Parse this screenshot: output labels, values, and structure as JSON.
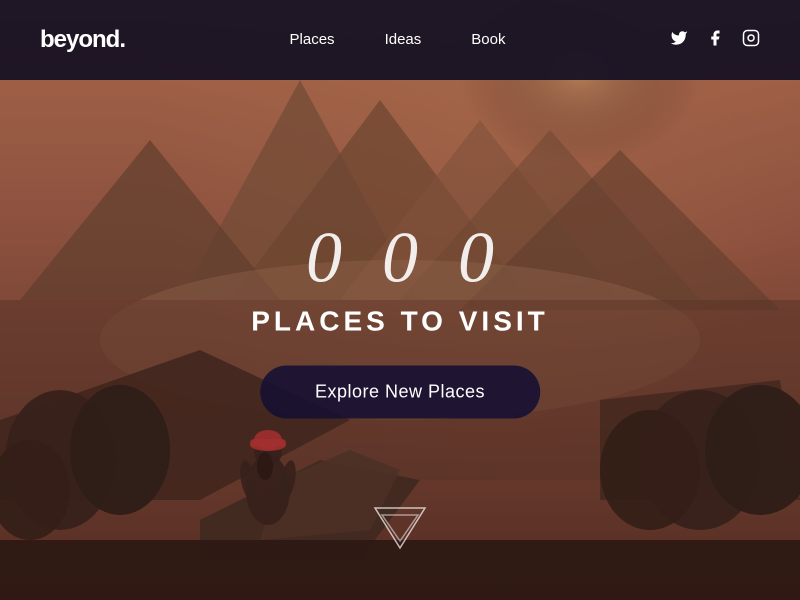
{
  "brand": {
    "logo": "beyond.",
    "dot_color": "#ffffff"
  },
  "nav": {
    "links": [
      {
        "label": "Places",
        "href": "#"
      },
      {
        "label": "Ideas",
        "href": "#"
      },
      {
        "label": "Book",
        "href": "#"
      }
    ],
    "social_icons": [
      {
        "name": "twitter-icon",
        "symbol": "𝕏"
      },
      {
        "name": "facebook-icon",
        "symbol": "f"
      },
      {
        "name": "instagram-icon",
        "symbol": "◻"
      }
    ]
  },
  "hero": {
    "counter": {
      "digits": [
        "0",
        "0",
        "0"
      ]
    },
    "subtitle": "PLACES TO VISIT",
    "cta_label": "Explore New Places"
  },
  "scroll": {
    "label": "scroll down"
  },
  "colors": {
    "navbar_bg": "rgba(20,15,35,0.92)",
    "cta_bg": "rgba(20,15,50,0.88)",
    "accent": "#ff6b6b",
    "text_primary": "#ffffff"
  }
}
